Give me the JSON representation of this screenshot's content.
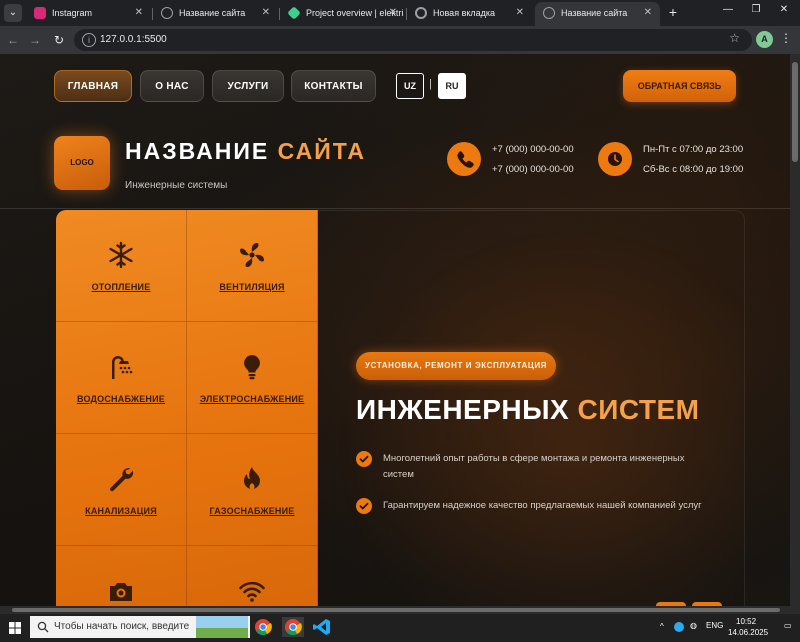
{
  "browser": {
    "tabs": [
      {
        "title": "Instagram",
        "favicon_color": "#d62976"
      },
      {
        "title": "Название сайта",
        "favicon_color": "#9aa0a6"
      },
      {
        "title": "Project overview | elektri",
        "favicon_color": "#3ecf8e"
      },
      {
        "title": "Новая вкладка",
        "favicon_color": "#9aa0a6"
      },
      {
        "title": "Название сайта",
        "favicon_color": "#9aa0a6",
        "active": true
      }
    ],
    "url": "127.0.0.1:5500",
    "profile_initial": "A"
  },
  "site": {
    "nav": {
      "home": "ГЛАВНАЯ",
      "about": "О НАС",
      "services": "УСЛУГИ",
      "contacts": "КОНТАКТЫ",
      "active": "home"
    },
    "languages": {
      "uz": "UZ",
      "separator": "|",
      "ru": "RU",
      "selected": "RU"
    },
    "feedback_button": "ОБРАТНАЯ СВЯЗЬ",
    "logo": "LOGO",
    "title_main": "НАЗВАНИЕ ",
    "title_accent": "САЙТА",
    "subtitle": "Инженерные системы",
    "phones": [
      "+7 (000) 000-00-00",
      "+7 (000) 000-00-00"
    ],
    "hours": [
      "Пн-Пт с 07:00 до 23:00",
      "Сб-Вс с 08:00 до 19:00"
    ],
    "services": [
      {
        "label": "ОТОПЛЕНИЕ",
        "icon": "snowflake-icon"
      },
      {
        "label": "ВЕНТИЛЯЦИЯ",
        "icon": "fan-icon"
      },
      {
        "label": "ВОДОСНАБЖЕНИЕ",
        "icon": "shower-icon"
      },
      {
        "label": "ЭЛЕКТРОСНАБЖЕНИЕ",
        "icon": "lightbulb-icon"
      },
      {
        "label": "КАНАЛИЗАЦИЯ",
        "icon": "wrench-icon"
      },
      {
        "label": "ГАЗОСНАБЖЕНИЕ",
        "icon": "flame-icon"
      },
      {
        "label": "",
        "icon": "camera-icon"
      },
      {
        "label": "",
        "icon": "wifi-icon"
      }
    ],
    "hero": {
      "badge": "УСТАНОВКА, РЕМОНТ И ЭКСПЛУАТАЦИЯ",
      "title_main": "ИНЖЕНЕРНЫХ ",
      "title_accent": "СИСТЕМ",
      "points": [
        "Многолетний опыт работы в сфере монтажа и ремонта инженерных систем",
        "Гарантируем надежное качество предлагаемых нашей компанией услуг"
      ]
    },
    "colors": {
      "accent": "#ec7a10",
      "accent_light": "#f5a04a",
      "background": "#17130f"
    }
  },
  "taskbar": {
    "search_placeholder": "Чтобы начать поиск, введите",
    "language": "ENG",
    "time": "10:52",
    "date": "14.06.2025"
  }
}
